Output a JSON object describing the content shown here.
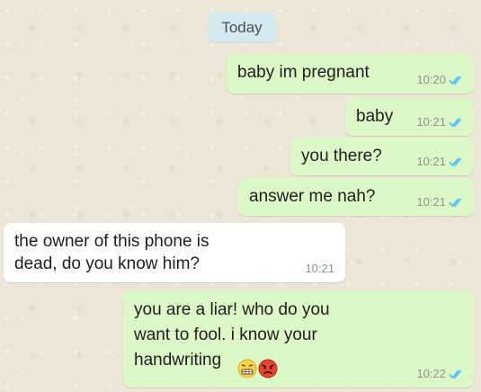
{
  "day_label": "Today",
  "messages": [
    {
      "text": "baby im pregnant",
      "time": "10:20",
      "direction": "outgoing",
      "status": "read"
    },
    {
      "text": "baby",
      "time": "10:21",
      "direction": "outgoing",
      "status": "read"
    },
    {
      "text": "you there?",
      "time": "10:21",
      "direction": "outgoing",
      "status": "read"
    },
    {
      "text": "answer me nah?",
      "time": "10:21",
      "direction": "outgoing",
      "status": "read"
    },
    {
      "text": "the owner of this phone is\ndead, do you know him?",
      "time": "10:21",
      "direction": "incoming"
    },
    {
      "text": "you are a liar! who do you\nwant to fool. i know your\nhandwriting",
      "time": "10:22",
      "direction": "outgoing",
      "status": "read",
      "emojis": [
        "grimacing-face",
        "angry-face"
      ]
    }
  ],
  "colors": {
    "outgoing_bubble": "#dcf8c6",
    "incoming_bubble": "#ffffff",
    "wallpaper": "#ece6d6",
    "read_ticks": "#4fc3f7",
    "day_chip": "#d6e9f2"
  }
}
